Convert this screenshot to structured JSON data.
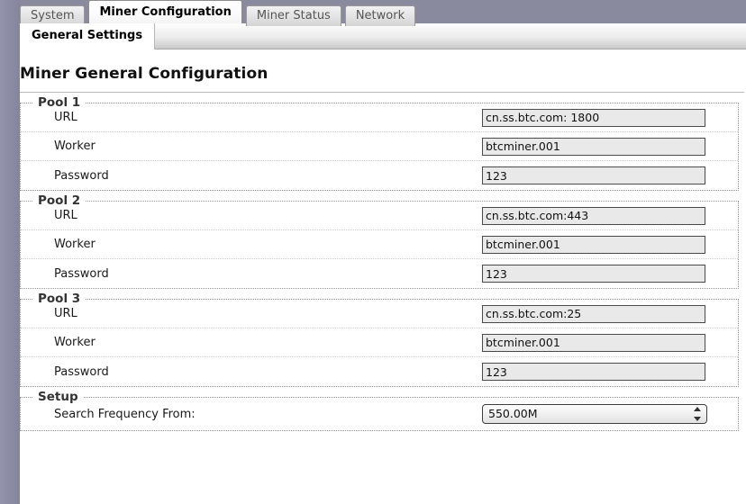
{
  "window": {
    "main_tabs": [
      {
        "label": "System",
        "active": false
      },
      {
        "label": "Miner Configuration",
        "active": true
      },
      {
        "label": "Miner Status",
        "active": false
      },
      {
        "label": "Network",
        "active": false
      }
    ],
    "sub_tabs": [
      {
        "label": "General Settings",
        "active": true
      }
    ]
  },
  "page": {
    "title": "Miner General Configuration"
  },
  "pools": [
    {
      "legend": "Pool 1",
      "rows": [
        {
          "label": "URL",
          "value": "cn.ss.btc.com: 1800"
        },
        {
          "label": "Worker",
          "value": "btcminer.001"
        },
        {
          "label": "Password",
          "value": "123"
        }
      ]
    },
    {
      "legend": "Pool 2",
      "rows": [
        {
          "label": "URL",
          "value": "cn.ss.btc.com:443"
        },
        {
          "label": "Worker",
          "value": "btcminer.001"
        },
        {
          "label": "Password",
          "value": "123"
        }
      ]
    },
    {
      "legend": "Pool 3",
      "rows": [
        {
          "label": "URL",
          "value": "cn.ss.btc.com:25"
        },
        {
          "label": "Worker",
          "value": "btcminer.001"
        },
        {
          "label": "Password",
          "value": "123"
        }
      ]
    }
  ],
  "setup": {
    "legend": "Setup",
    "frequency_label": "Search Frequency From:",
    "frequency_value": "550.00M"
  },
  "colors": {
    "rail": "#8b8ba4",
    "top_band": "#8a8a9e",
    "input_bg": "#e9e9e9",
    "active_tab_bg": "#ffffff"
  },
  "icons": {
    "stepper_up": "stepper-up-arrow-icon",
    "stepper_down": "stepper-down-arrow-icon"
  }
}
